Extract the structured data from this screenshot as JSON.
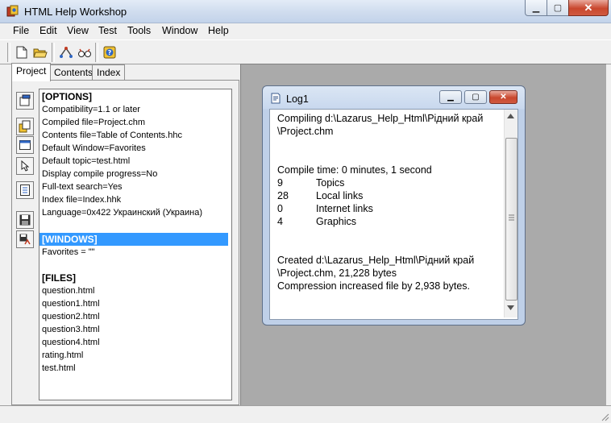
{
  "window": {
    "title": "HTML Help Workshop"
  },
  "menu": [
    "File",
    "Edit",
    "View",
    "Test",
    "Tools",
    "Window",
    "Help"
  ],
  "toolbar": {
    "icons": [
      "new-icon",
      "open-icon",
      "compile-icon",
      "view-compiled-icon",
      "help-icon"
    ]
  },
  "tabs": [
    {
      "label": "Project",
      "active": true
    },
    {
      "label": "Contents",
      "active": false
    },
    {
      "label": "Index",
      "active": false
    }
  ],
  "project": {
    "options_header": "[OPTIONS]",
    "options": [
      "Compatibility=1.1 or later",
      "Compiled file=Project.chm",
      "Contents file=Table of Contents.hhc",
      "Default Window=Favorites",
      "Default topic=test.html",
      "Display compile progress=No",
      "Full-text search=Yes",
      "Index file=Index.hhk",
      "Language=0x422 Украинский (Украина)"
    ],
    "windows_header": "[WINDOWS]",
    "windows": [
      "Favorites = \"\""
    ],
    "files_header": "[FILES]",
    "files": [
      "question.html",
      "question1.html",
      "question2.html",
      "question3.html",
      "question4.html",
      "rating.html",
      "test.html"
    ]
  },
  "log": {
    "title": "Log1",
    "compiling_line1": "Compiling d:\\Lazarus_Help_Html\\Рідний край",
    "compiling_line2": "\\Project.chm",
    "compile_time": "Compile time: 0 minutes, 1 second",
    "stats": [
      {
        "count": "9",
        "label": "Topics"
      },
      {
        "count": "28",
        "label": "Local links"
      },
      {
        "count": "0",
        "label": "Internet links"
      },
      {
        "count": "4",
        "label": "Graphics"
      }
    ],
    "created_line1": "Created d:\\Lazarus_Help_Html\\Рідний край",
    "created_line2": "\\Project.chm, 21,228 bytes",
    "compression": "Compression increased file by 2,938 bytes."
  },
  "colors": {
    "selection": "#3399ff",
    "client_bg": "#aaaaaa"
  }
}
